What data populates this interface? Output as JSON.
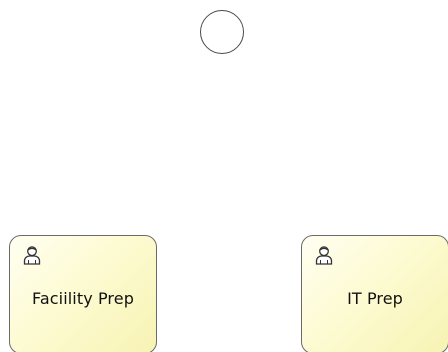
{
  "diagram": {
    "start_event": {
      "icon": "start-event-circle"
    },
    "tasks": [
      {
        "label": "Faciility Prep",
        "icon": "user-task-icon"
      },
      {
        "label": "IT Prep",
        "icon": "user-task-icon"
      }
    ]
  }
}
